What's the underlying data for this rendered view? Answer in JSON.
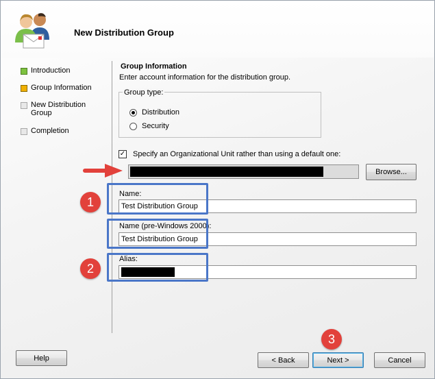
{
  "header": {
    "title": "New Distribution Group",
    "icon": "users-envelope-icon"
  },
  "sidebar": {
    "items": [
      {
        "label": "Introduction",
        "status": "done"
      },
      {
        "label": "Group Information",
        "status": "current"
      },
      {
        "label": "New Distribution Group",
        "status": "pending"
      },
      {
        "label": "Completion",
        "status": "pending"
      }
    ]
  },
  "main": {
    "section_title": "Group Information",
    "section_description": "Enter account information for the distribution group.",
    "group_type": {
      "legend": "Group type:",
      "options": [
        {
          "label": "Distribution",
          "checked": true
        },
        {
          "label": "Security",
          "checked": false
        }
      ]
    },
    "ou_checkbox": {
      "label": "Specify an Organizational Unit rather than using a default one:",
      "checked": true
    },
    "browse_label": "Browse...",
    "name": {
      "label": "Name:",
      "value": "Test Distribution Group"
    },
    "name_pre2000": {
      "label": "Name (pre-Windows 2000):",
      "value": "Test Distribution Group"
    },
    "alias": {
      "label": "Alias:"
    }
  },
  "annotations": {
    "badges": [
      "1",
      "2",
      "3"
    ],
    "highlight_color": "#4a76c8",
    "badge_color": "#e2413b",
    "arrow_color": "#e2413b"
  },
  "footer": {
    "help_label": "Help",
    "back_label": "< Back",
    "next_label": "Next >",
    "cancel_label": "Cancel"
  }
}
